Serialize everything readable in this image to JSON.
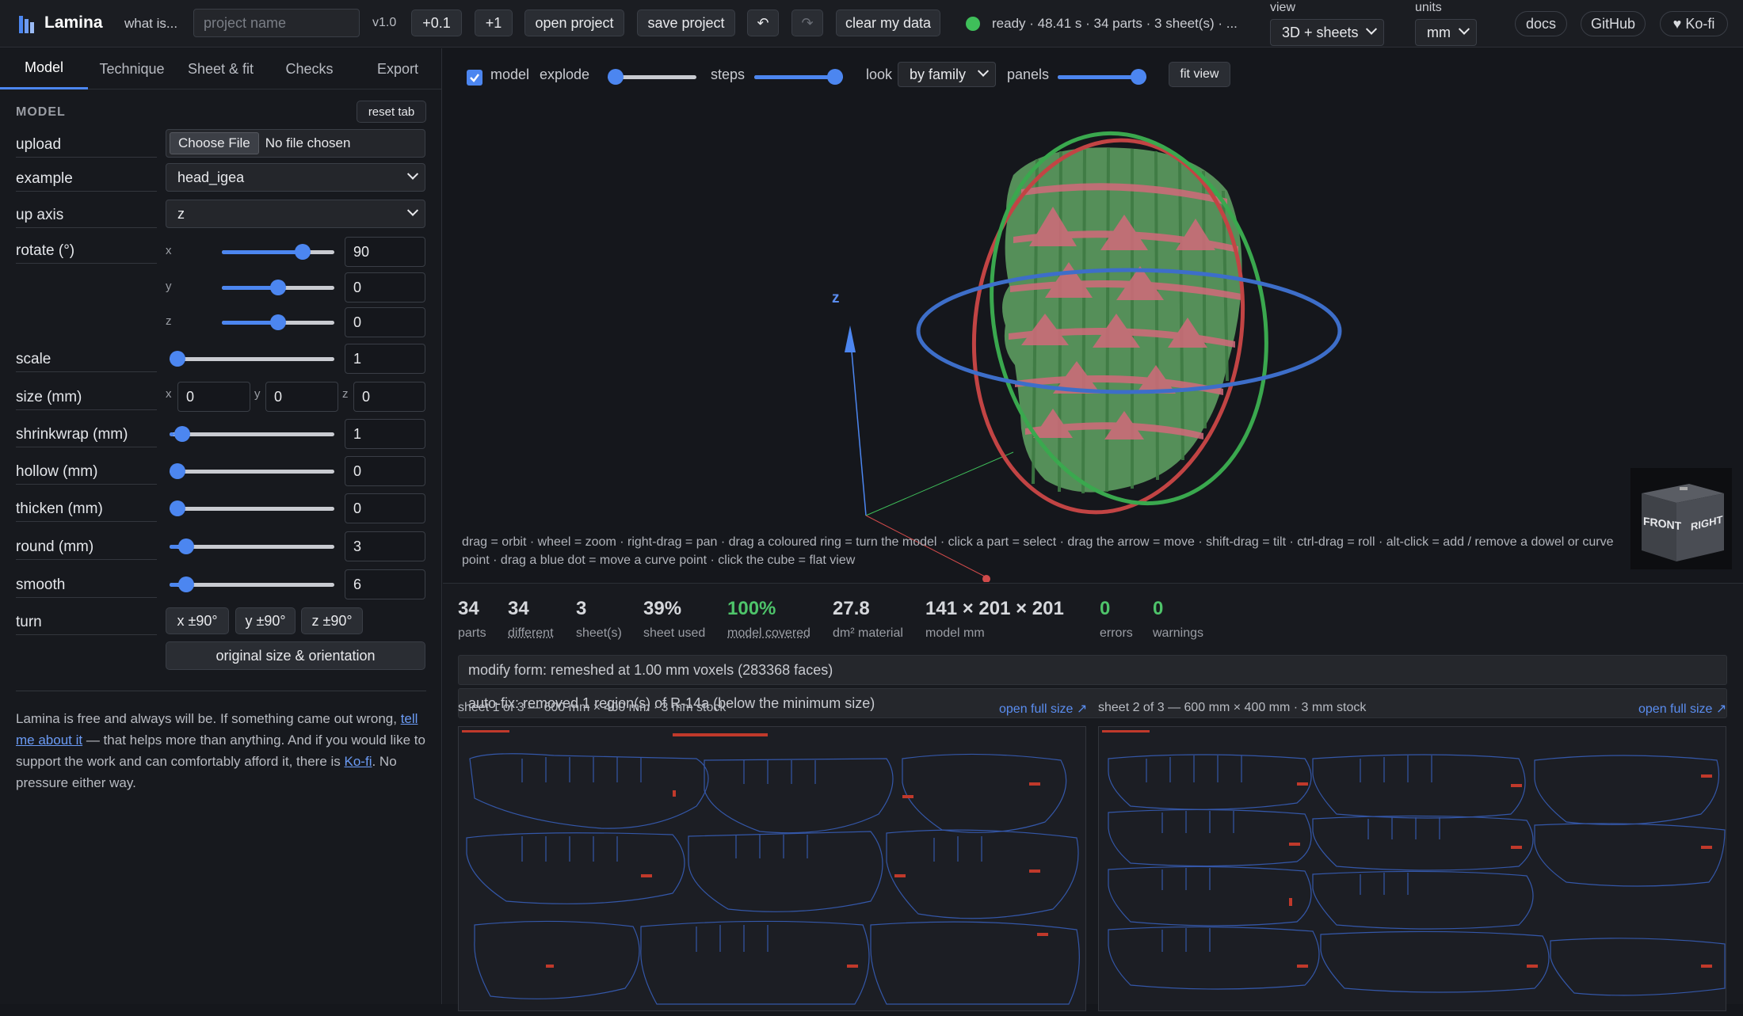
{
  "app": {
    "name": "Lamina",
    "what_is": "what is...",
    "version": "v1.0"
  },
  "topbar": {
    "project_placeholder": "project name",
    "bump_minor": "+0.1",
    "bump_major": "+1",
    "open_project": "open project",
    "save_project": "save project",
    "undo": "↶",
    "redo": "↷",
    "clear": "clear my data",
    "status": "ready · 48.41 s · 34 parts · 3 sheet(s) · ...",
    "view_label": "view",
    "view_value": "3D + sheets",
    "units_label": "units",
    "units_value": "mm",
    "docs": "docs",
    "github": "GitHub",
    "kofi": "♥ Ko-fi",
    "colors": {
      "status_ok": "#3fbf5a",
      "accent": "#4c86f0"
    }
  },
  "sidebar": {
    "tabs": [
      "Model",
      "Technique",
      "Sheet & fit",
      "Checks",
      "Export"
    ],
    "section": "MODEL",
    "reset": "reset tab",
    "upload": {
      "label": "upload",
      "button": "Choose File",
      "status": "No file chosen"
    },
    "example": {
      "label": "example",
      "value": "head_igea"
    },
    "up_axis": {
      "label": "up axis",
      "value": "z"
    },
    "rotate": {
      "label": "rotate (°)",
      "x_label": "x",
      "y_label": "y",
      "z_label": "z",
      "x": "90",
      "y": "0",
      "z": "0",
      "x_level": 0.75,
      "y_level": 0.5,
      "z_level": 0.5
    },
    "scale": {
      "label": "scale",
      "value": "1",
      "level": 0.0
    },
    "size": {
      "label": "size (mm)",
      "x_label": "x",
      "y_label": "y",
      "z_label": "z",
      "x": "0",
      "y": "0",
      "z": "0"
    },
    "shrinkwrap": {
      "label": "shrinkwrap (mm)",
      "value": "1",
      "level": 0.03
    },
    "hollow": {
      "label": "hollow (mm)",
      "value": "0",
      "level": 0.0
    },
    "thicken": {
      "label": "thicken (mm)",
      "value": "0",
      "level": 0.0
    },
    "round": {
      "label": "round (mm)",
      "value": "3",
      "level": 0.06
    },
    "smooth": {
      "label": "smooth",
      "value": "6",
      "level": 0.06
    },
    "turn": {
      "label": "turn",
      "x": "x ±90°",
      "y": "y ±90°",
      "z": "z ±90°"
    },
    "reset_orientation": "original size & orientation",
    "footer": {
      "part1": "Lamina is free and always will be. If something came out wrong, ",
      "link1": "tell me about it",
      "part2": " — that helps more than anything. And if you would like to support the work and can comfortably afford it, there is ",
      "link2": "Ko-fi",
      "part3": ". No pressure either way."
    }
  },
  "viewport": {
    "model_label": "model",
    "explode_label": "explode",
    "explode_level": 0.0,
    "steps_label": "steps",
    "steps_level": 1.0,
    "look_label": "look",
    "look_value": "by family",
    "panels_label": "panels",
    "panels_level": 1.0,
    "fit_view": "fit view",
    "axis_z": "z",
    "cube_front": "FRONT",
    "cube_right": "RIGHT",
    "hint": "drag = orbit · wheel = zoom · right-drag = pan · drag a coloured ring = turn the model · click a part = select · drag the arrow = move · shift-drag = tilt · ctrl-drag = roll · alt-click = add / remove a dowel or curve point · drag a blue dot = move a curve point · click the cube = flat view"
  },
  "stats": [
    {
      "value": "34",
      "label": "parts",
      "underline": false,
      "color": "#d6d8dc"
    },
    {
      "value": "34",
      "label": "different",
      "underline": true,
      "color": "#d6d8dc"
    },
    {
      "value": "3",
      "label": "sheet(s)",
      "underline": false,
      "color": "#d6d8dc"
    },
    {
      "value": "39%",
      "label": "sheet used",
      "underline": false,
      "color": "#d6d8dc"
    },
    {
      "value": "100%",
      "label": "model covered",
      "underline": true,
      "color": "#4ec46a"
    },
    {
      "value": "27.8",
      "label": "dm² material",
      "underline": false,
      "color": "#d6d8dc"
    },
    {
      "value": "141 × 201 × 201",
      "label": "model mm",
      "underline": false,
      "color": "#d6d8dc"
    },
    {
      "value": "0",
      "label": "errors",
      "underline": false,
      "color": "#4ec46a"
    },
    {
      "value": "0",
      "label": "warnings",
      "underline": false,
      "color": "#4ec46a"
    }
  ],
  "messages": [
    "modify form: remeshed at 1.00 mm voxels (283368 faces)",
    "auto-fix: removed 1 region(s) of R-14a (below the minimum size)"
  ],
  "sheets": [
    {
      "caption": "sheet 1 of 3 — 600 mm × 400 mm · 3 mm stock",
      "link": "open full size ↗"
    },
    {
      "caption": "sheet 2 of 3 — 600 mm × 400 mm · 3 mm stock",
      "link": "open full size ↗"
    }
  ]
}
